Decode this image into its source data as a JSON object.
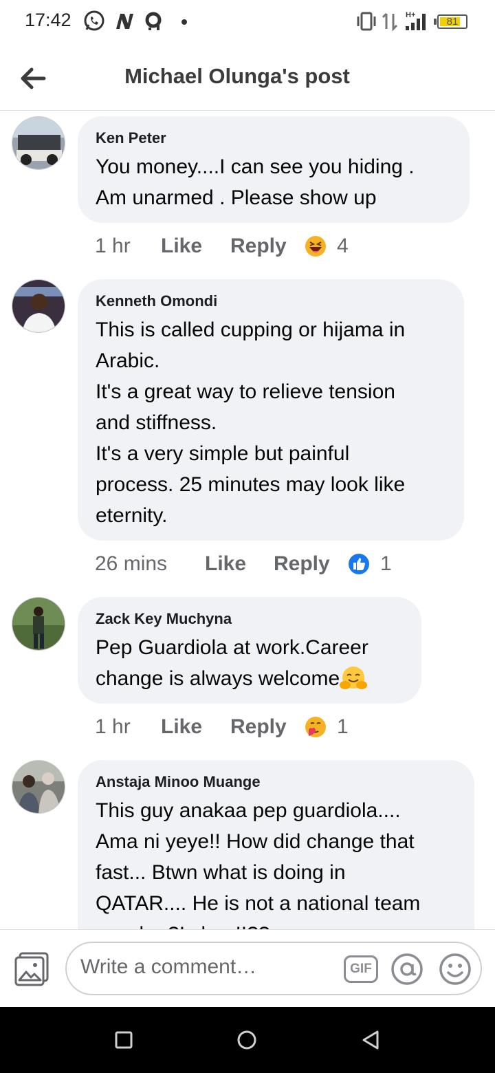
{
  "status_bar": {
    "time": "17:42",
    "network": "H+",
    "battery": "81",
    "battery_level": 0.81,
    "icons": [
      "whatsapp-icon",
      "n-app-icon",
      "notification-icon",
      "dot-icon",
      "vibrate-icon",
      "data-arrows-icon",
      "signal-icon",
      "battery-icon"
    ]
  },
  "header": {
    "title": "Michael Olunga's post",
    "back_icon": "arrow-left-icon"
  },
  "comments": [
    {
      "author": "Ken Peter",
      "text": "You money....I can see you hiding .\nAm  unarmed . Please show up",
      "time": "1 hr",
      "like": "Like",
      "reply": "Reply",
      "reaction": "haha-icon",
      "reaction_count": "4"
    },
    {
      "author": "Kenneth Omondi",
      "text": "This is called cupping or hijama in\nArabic.\nIt's a great way to relieve tension\nand stiffness.\nIt's a very simple but painful\nprocess. 25 minutes may look like\neternity.",
      "time": "26 mins",
      "like": "Like",
      "reply": "Reply",
      "reaction": "like-icon",
      "reaction_count": "1"
    },
    {
      "author": "Zack Key Muchyna",
      "text": "Pep Guardiola at work.Career\nchange is always welcome",
      "time": "1 hr",
      "like": "Like",
      "reply": "Reply",
      "reaction": "care-icon",
      "reaction_count": "1"
    },
    {
      "author": "Anstaja Minoo Muange",
      "text": "This guy anakaa pep guardiola....\nAma ni yeye!!  How did change that\nfast... Btwn what is doing in\nQATAR.... He is not a national team\ncoach...?Is he..!!??"
    }
  ],
  "composer": {
    "placeholder": "Write a comment…",
    "gif": "GIF",
    "photo_icon": "photo-icon",
    "mention_icon": "at-icon",
    "emoji_icon": "smiley-icon"
  },
  "navbar": {
    "icons": [
      "recent-apps-icon",
      "home-icon",
      "back-icon"
    ]
  },
  "colors": {
    "bubble": "#f0f2f5",
    "meta": "#65676b",
    "like_blue": "#1877f2",
    "battery_yellow": "#f0d000"
  }
}
